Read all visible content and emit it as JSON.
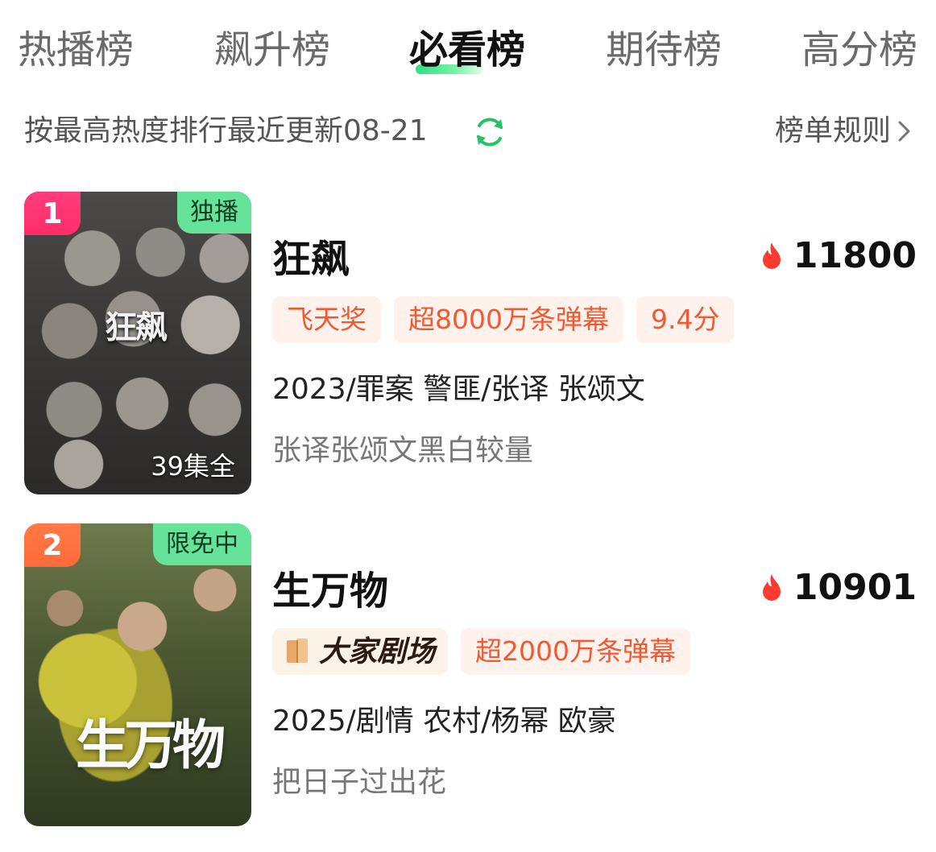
{
  "tabs": [
    {
      "label": "热播榜",
      "active": false
    },
    {
      "label": "飙升榜",
      "active": false
    },
    {
      "label": "必看榜",
      "active": true
    },
    {
      "label": "期待榜",
      "active": false
    },
    {
      "label": "高分榜",
      "active": false
    }
  ],
  "subbar": {
    "sort_text": "按最高热度排行最近更新08-21",
    "rules_label": "榜单规则",
    "refresh_icon": "refresh-icon",
    "accent_color": "#27c266"
  },
  "items": [
    {
      "rank": "1",
      "corner_tag": "独播",
      "poster_title": "狂飙",
      "episodes": "39集全",
      "title": "狂飙",
      "heat": "11800",
      "tags": [
        "飞天奖",
        "超8000万条弹幕",
        "9.4分"
      ],
      "meta": "2023/罪案 警匪/张译 张颂文",
      "desc": "张译张颂文黑白较量"
    },
    {
      "rank": "2",
      "corner_tag": "限免中",
      "poster_title": "生万物",
      "title": "生万物",
      "heat": "10901",
      "brand_tag": "大家剧场",
      "tags": [
        "超2000万条弹幕"
      ],
      "meta": "2025/剧情 农村/杨幂 欧豪",
      "desc": "把日子过出花"
    }
  ],
  "colors": {
    "rank1": "#ff2d6a",
    "rank2": "#ff6a3a",
    "tag_text": "#f05a32",
    "tag_bg": "#fff1ec",
    "corner_tag_bg": "#66e39b",
    "heat_icon": "#ff3b30"
  }
}
